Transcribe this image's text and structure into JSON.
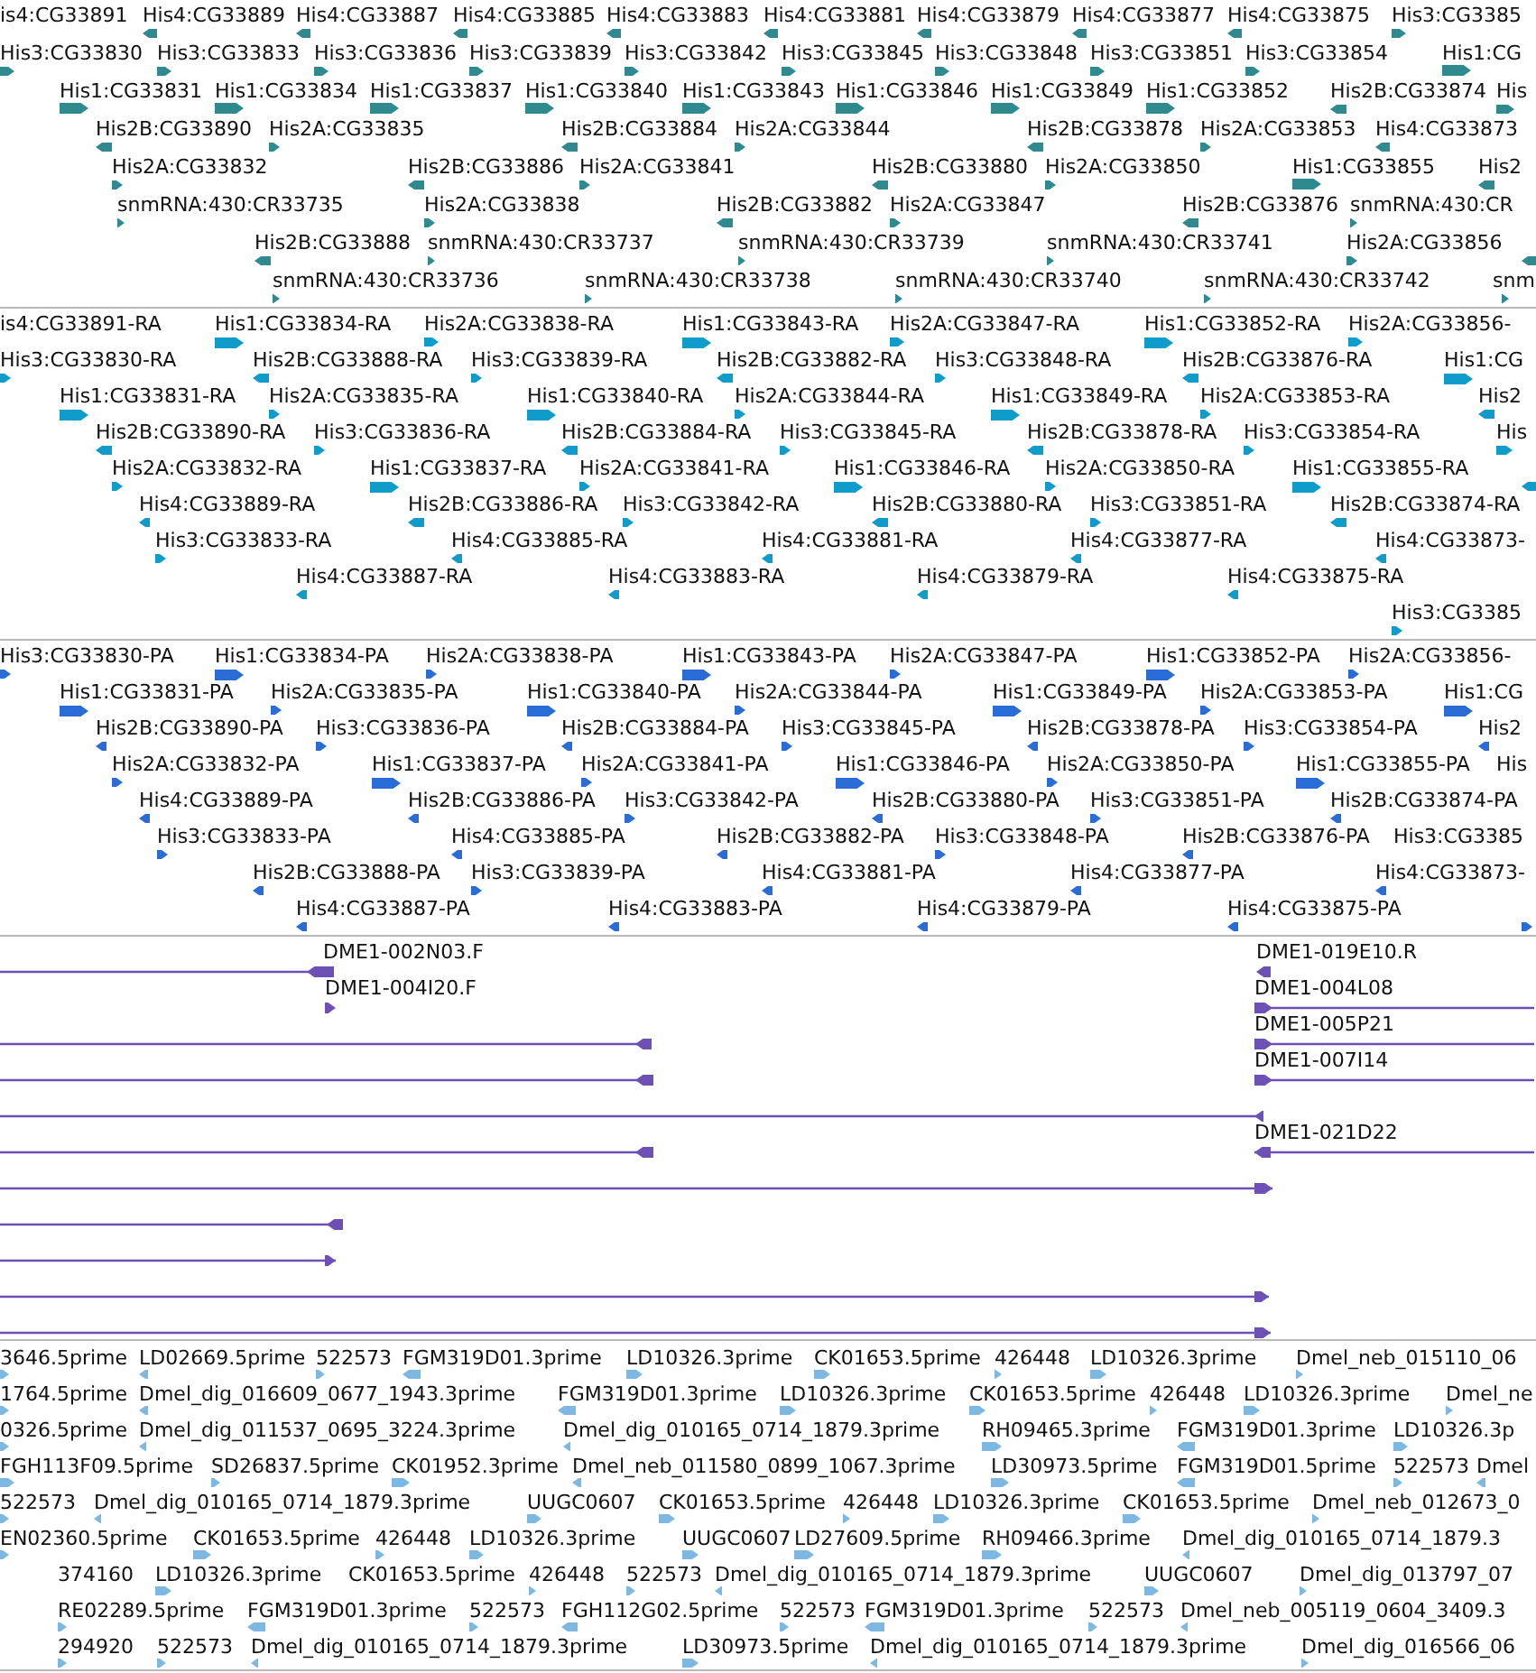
{
  "tracks": [
    {
      "kind": "glyph",
      "rows": [
        {
          "features": [
            {
              "label": "is4:CG33891"
            },
            {
              "label": "His4:CG33889",
              "reverse": true
            },
            {
              "label": "His4:CG33887",
              "reverse": true
            },
            {
              "label": "His4:CG33885",
              "reverse": true
            },
            {
              "label": "His4:CG33883",
              "reverse": true
            },
            {
              "label": "His4:CG33881",
              "reverse": true
            },
            {
              "label": "His4:CG33879",
              "reverse": true
            },
            {
              "label": "His4:CG33877",
              "reverse": true
            },
            {
              "label": "His4:CG33875",
              "reverse": true
            },
            {
              "label": "His3:CG3385",
              "reverse": false
            }
          ]
        },
        {
          "features": [
            {
              "label": "His3:CG33830",
              "reverse": false
            },
            {
              "label": "His3:CG33833",
              "reverse": false
            },
            {
              "label": "His3:CG33836",
              "reverse": false
            },
            {
              "label": "His3:CG33839",
              "reverse": false
            },
            {
              "label": "His3:CG33842",
              "reverse": false
            },
            {
              "label": "His3:CG33845",
              "reverse": false
            },
            {
              "label": "His3:CG33848",
              "reverse": false
            },
            {
              "label": "His3:CG33851",
              "reverse": false
            },
            {
              "label": "His3:CG33854",
              "reverse": false
            },
            {
              "label": "His1:CG",
              "reverse": false
            }
          ]
        },
        {
          "features": [
            {
              "label": "His1:CG33831",
              "reverse": false
            },
            {
              "label": "His1:CG33834",
              "reverse": false
            },
            {
              "label": "His1:CG33837",
              "reverse": false
            },
            {
              "label": "His1:CG33840",
              "reverse": false
            },
            {
              "label": "His1:CG33843",
              "reverse": false
            },
            {
              "label": "His1:CG33846",
              "reverse": false
            },
            {
              "label": "His1:CG33849",
              "reverse": false
            },
            {
              "label": "His1:CG33852",
              "reverse": false
            },
            {
              "label": "His2B:CG33874",
              "reverse": true
            },
            {
              "label": "His",
              "reverse": false
            }
          ]
        },
        {
          "features": [
            {
              "label": "His2B:CG33890",
              "reverse": true
            },
            {
              "label": "His2A:CG33835",
              "reverse": false
            },
            {
              "label": "His2B:CG33884",
              "reverse": true
            },
            {
              "label": "His2A:CG33844",
              "reverse": false
            },
            {
              "label": "His2B:CG33878",
              "reverse": true
            },
            {
              "label": "His2A:CG33853",
              "reverse": false
            },
            {
              "label": "His4:CG33873",
              "reverse": true
            }
          ]
        },
        {
          "features": [
            {
              "label": "His2A:CG33832",
              "reverse": false
            },
            {
              "label": "His2B:CG33886",
              "reverse": true
            },
            {
              "label": "His2A:CG33841",
              "reverse": false
            },
            {
              "label": "His2B:CG33880",
              "reverse": true
            },
            {
              "label": "His2A:CG33850",
              "reverse": false
            },
            {
              "label": "His1:CG33855",
              "reverse": false
            },
            {
              "label": "His2",
              "reverse": true
            }
          ]
        },
        {
          "features": [
            {
              "label": "snmRNA:430:CR33735",
              "reverse": false
            },
            {
              "label": "His2A:CG33838",
              "reverse": false
            },
            {
              "label": "His2B:CG33882",
              "reverse": true
            },
            {
              "label": "His2A:CG33847",
              "reverse": false
            },
            {
              "label": "His2B:CG33876",
              "reverse": true
            },
            {
              "label": "snmRNA:430:CR",
              "reverse": false
            }
          ]
        },
        {
          "features": [
            {
              "label": "His2B:CG33888",
              "reverse": true
            },
            {
              "label": "snmRNA:430:CR33737",
              "reverse": false
            },
            {
              "label": "snmRNA:430:CR33739",
              "reverse": false
            },
            {
              "label": "snmRNA:430:CR33741",
              "reverse": false
            },
            {
              "label": "His2A:CG33856",
              "reverse": false
            },
            {
              "reverse": true
            }
          ]
        },
        {
          "features": [
            {
              "label": "snmRNA:430:CR33736",
              "reverse": false
            },
            {
              "label": "snmRNA:430:CR33738",
              "reverse": false
            },
            {
              "label": "snmRNA:430:CR33740",
              "reverse": false
            },
            {
              "label": "snmRNA:430:CR33742",
              "reverse": false
            },
            {
              "label": "snm",
              "reverse": false
            }
          ]
        }
      ]
    },
    {
      "kind": "glyph",
      "rows": [
        {
          "features": [
            {
              "label": "is4:CG33891-RA"
            },
            {
              "label": "His1:CG33834-RA",
              "reverse": false
            },
            {
              "label": "His2A:CG33838-RA",
              "reverse": false
            },
            {
              "label": "His1:CG33843-RA",
              "reverse": false
            },
            {
              "label": "His2A:CG33847-RA",
              "reverse": false
            },
            {
              "label": "His1:CG33852-RA",
              "reverse": false
            },
            {
              "label": "His2A:CG33856-",
              "reverse": false
            }
          ]
        },
        {
          "features": [
            {
              "label": "His3:CG33830-RA",
              "reverse": false
            },
            {
              "label": "His2B:CG33888-RA",
              "reverse": true
            },
            {
              "label": "His3:CG33839-RA",
              "reverse": false
            },
            {
              "label": "His2B:CG33882-RA",
              "reverse": true
            },
            {
              "label": "His3:CG33848-RA",
              "reverse": false
            },
            {
              "label": "His2B:CG33876-RA",
              "reverse": true
            },
            {
              "label": "His1:CG",
              "reverse": false
            }
          ]
        },
        {
          "features": [
            {
              "label": "His1:CG33831-RA",
              "reverse": false
            },
            {
              "label": "His2A:CG33835-RA",
              "reverse": false
            },
            {
              "label": "His1:CG33840-RA",
              "reverse": false
            },
            {
              "label": "His2A:CG33844-RA",
              "reverse": false
            },
            {
              "label": "His1:CG33849-RA",
              "reverse": false
            },
            {
              "label": "His2A:CG33853-RA",
              "reverse": false
            },
            {
              "label": "His2",
              "reverse": true
            }
          ]
        },
        {
          "features": [
            {
              "label": "His2B:CG33890-RA",
              "reverse": true
            },
            {
              "label": "His3:CG33836-RA",
              "reverse": false
            },
            {
              "label": "His2B:CG33884-RA",
              "reverse": true
            },
            {
              "label": "His3:CG33845-RA",
              "reverse": false
            },
            {
              "label": "His2B:CG33878-RA",
              "reverse": true
            },
            {
              "label": "His3:CG33854-RA",
              "reverse": false
            },
            {
              "label": "His",
              "reverse": false
            }
          ]
        },
        {
          "features": [
            {
              "label": "His2A:CG33832-RA",
              "reverse": false
            },
            {
              "label": "His1:CG33837-RA",
              "reverse": false
            },
            {
              "label": "His2A:CG33841-RA",
              "reverse": false
            },
            {
              "label": "His1:CG33846-RA",
              "reverse": false
            },
            {
              "label": "His2A:CG33850-RA",
              "reverse": false
            },
            {
              "label": "His1:CG33855-RA",
              "reverse": false
            },
            {
              "reverse": true
            }
          ]
        },
        {
          "features": [
            {
              "label": "His4:CG33889-RA",
              "reverse": true
            },
            {
              "label": "His2B:CG33886-RA",
              "reverse": true
            },
            {
              "label": "His3:CG33842-RA",
              "reverse": false
            },
            {
              "label": "His2B:CG33880-RA",
              "reverse": true
            },
            {
              "label": "His3:CG33851-RA",
              "reverse": false
            },
            {
              "label": "His2B:CG33874-RA",
              "reverse": true
            }
          ]
        },
        {
          "features": [
            {
              "label": "His3:CG33833-RA",
              "reverse": false
            },
            {
              "label": "His4:CG33885-RA",
              "reverse": true
            },
            {
              "label": "His4:CG33881-RA",
              "reverse": true
            },
            {
              "label": "His4:CG33877-RA",
              "reverse": true
            },
            {
              "label": "His4:CG33873-",
              "reverse": true
            }
          ]
        },
        {
          "features": [
            {
              "label": "His4:CG33887-RA",
              "reverse": true
            },
            {
              "label": "His4:CG33883-RA",
              "reverse": true
            },
            {
              "label": "His4:CG33879-RA",
              "reverse": true
            },
            {
              "label": "His4:CG33875-RA",
              "reverse": true
            }
          ]
        },
        {
          "features": [
            {
              "label": "His3:CG3385",
              "reverse": false
            }
          ]
        }
      ]
    },
    {
      "kind": "glyph",
      "rows": [
        {
          "features": [
            {
              "label": "His3:CG33830-PA",
              "reverse": false
            },
            {
              "label": "His1:CG33834-PA",
              "reverse": false
            },
            {
              "label": "His2A:CG33838-PA",
              "reverse": false
            },
            {
              "label": "His1:CG33843-PA",
              "reverse": false
            },
            {
              "label": "His2A:CG33847-PA",
              "reverse": false
            },
            {
              "label": "His1:CG33852-PA",
              "reverse": false
            },
            {
              "label": "His2A:CG33856-",
              "reverse": false
            }
          ]
        },
        {
          "features": [
            {
              "label": "His1:CG33831-PA",
              "reverse": false
            },
            {
              "label": "His2A:CG33835-PA",
              "reverse": false
            },
            {
              "label": "His1:CG33840-PA",
              "reverse": false
            },
            {
              "label": "His2A:CG33844-PA",
              "reverse": false
            },
            {
              "label": "His1:CG33849-PA",
              "reverse": false
            },
            {
              "label": "His2A:CG33853-PA",
              "reverse": false
            },
            {
              "label": "His1:CG",
              "reverse": false
            }
          ]
        },
        {
          "features": [
            {
              "label": "His2B:CG33890-PA",
              "reverse": true
            },
            {
              "label": "His3:CG33836-PA",
              "reverse": false
            },
            {
              "label": "His2B:CG33884-PA",
              "reverse": true
            },
            {
              "label": "His3:CG33845-PA",
              "reverse": false
            },
            {
              "label": "His2B:CG33878-PA",
              "reverse": true
            },
            {
              "label": "His3:CG33854-PA",
              "reverse": false
            },
            {
              "label": "His2",
              "reverse": true
            }
          ]
        },
        {
          "features": [
            {
              "label": "His2A:CG33832-PA",
              "reverse": false
            },
            {
              "label": "His1:CG33837-PA",
              "reverse": false
            },
            {
              "label": "His2A:CG33841-PA",
              "reverse": false
            },
            {
              "label": "His1:CG33846-PA",
              "reverse": false
            },
            {
              "label": "His2A:CG33850-PA",
              "reverse": false
            },
            {
              "label": "His1:CG33855-PA",
              "reverse": false
            },
            {
              "label": "His"
            }
          ]
        },
        {
          "features": [
            {
              "label": "His4:CG33889-PA",
              "reverse": true
            },
            {
              "label": "His2B:CG33886-PA",
              "reverse": true
            },
            {
              "label": "His3:CG33842-PA",
              "reverse": false
            },
            {
              "label": "His2B:CG33880-PA",
              "reverse": true
            },
            {
              "label": "His3:CG33851-PA",
              "reverse": false
            },
            {
              "label": "His2B:CG33874-PA",
              "reverse": true
            }
          ]
        },
        {
          "features": [
            {
              "label": "His3:CG33833-PA",
              "reverse": false
            },
            {
              "label": "His4:CG33885-PA",
              "reverse": true
            },
            {
              "label": "His2B:CG33882-PA",
              "reverse": true
            },
            {
              "label": "His3:CG33848-PA",
              "reverse": false
            },
            {
              "label": "His2B:CG33876-PA",
              "reverse": true
            },
            {
              "label": "His3:CG3385"
            }
          ]
        },
        {
          "features": [
            {
              "label": "His2B:CG33888-PA",
              "reverse": true
            },
            {
              "label": "His3:CG33839-PA",
              "reverse": false
            },
            {
              "label": "His4:CG33881-PA",
              "reverse": true
            },
            {
              "label": "His4:CG33877-PA",
              "reverse": true
            },
            {
              "label": "His4:CG33873-",
              "reverse": true
            }
          ]
        },
        {
          "features": [
            {
              "label": "His4:CG33887-PA",
              "reverse": true
            },
            {
              "label": "His4:CG33883-PA",
              "reverse": true
            },
            {
              "label": "His4:CG33879-PA",
              "reverse": true
            },
            {
              "label": "His4:CG33875-PA",
              "reverse": true
            },
            {
              "reverse": false
            }
          ]
        }
      ]
    },
    {
      "kind": "span",
      "rows": [
        {
          "features": [
            {
              "label": "DME1-002N03.F",
              "reverse": true
            },
            {
              "label": "DME1-019E10.R",
              "reverse": true
            }
          ]
        },
        {
          "features": [
            {
              "label": "DME1-004I20.F",
              "reverse": false
            },
            {
              "label": "DME1-004L08",
              "reverse": false
            }
          ]
        },
        {
          "features": [
            {
              "reverse": true
            },
            {
              "label": "DME1-005P21",
              "reverse": false
            }
          ]
        },
        {
          "features": [
            {
              "reverse": true
            },
            {
              "label": "DME1-007I14",
              "reverse": false
            }
          ]
        },
        {
          "features": [
            {
              "reverse": true
            }
          ]
        },
        {
          "features": [
            {
              "reverse": true
            },
            {
              "label": "DME1-021D22",
              "reverse": true
            }
          ]
        },
        {
          "features": [
            {
              "reverse": false
            }
          ]
        },
        {
          "features": [
            {
              "reverse": true
            }
          ]
        },
        {
          "features": [
            {
              "reverse": false
            }
          ]
        },
        {
          "features": [
            {
              "reverse": false
            }
          ]
        },
        {
          "features": [
            {
              "reverse": false
            }
          ]
        }
      ]
    },
    {
      "kind": "glyph",
      "rows": [
        {
          "features": [
            {
              "label": "3646.5prime",
              "reverse": false
            },
            {
              "label": "LD02669.5prime",
              "reverse": true
            },
            {
              "label": "522573",
              "reverse": false
            },
            {
              "label": "FGM319D01.3prime",
              "reverse": true
            },
            {
              "label": "LD10326.3prime",
              "reverse": false
            },
            {
              "label": "CK01653.5prime",
              "reverse": false
            },
            {
              "label": "426448",
              "reverse": false
            },
            {
              "label": "LD10326.3prime",
              "reverse": false
            },
            {
              "label": "Dmel_neb_015110_06",
              "reverse": false
            }
          ]
        },
        {
          "features": [
            {
              "label": "1764.5prime",
              "reverse": false
            },
            {
              "label": "Dmel_dig_016609_0677_1943.3prime",
              "reverse": true
            },
            {
              "label": "FGM319D01.3prime",
              "reverse": true
            },
            {
              "label": "LD10326.3prime",
              "reverse": false
            },
            {
              "label": "CK01653.5prime",
              "reverse": false
            },
            {
              "label": "426448",
              "reverse": false
            },
            {
              "label": "LD10326.3prime",
              "reverse": false
            },
            {
              "label": "Dmel_ne",
              "reverse": false
            }
          ]
        },
        {
          "features": [
            {
              "label": "0326.5prime",
              "reverse": false
            },
            {
              "label": "Dmel_dig_011537_0695_3224.3prime",
              "reverse": true
            },
            {
              "label": "Dmel_dig_010165_0714_1879.3prime",
              "reverse": true
            },
            {
              "label": "RH09465.3prime",
              "reverse": false
            },
            {
              "label": "FGM319D01.3prime",
              "reverse": true
            },
            {
              "label": "LD10326.3p",
              "reverse": false
            }
          ]
        },
        {
          "features": [
            {
              "label": "FGH113F09.5prime",
              "reverse": false
            },
            {
              "label": "SD26837.5prime",
              "reverse": false
            },
            {
              "label": "CK01952.3prime",
              "reverse": false
            },
            {
              "label": "Dmel_neb_011580_0899_1067.3prime",
              "reverse": true
            },
            {
              "label": "LD30973.5prime",
              "reverse": false
            },
            {
              "label": "FGM319D01.5prime",
              "reverse": true
            },
            {
              "label": "522573",
              "reverse": false
            },
            {
              "label": "Dmel",
              "reverse": true
            }
          ]
        },
        {
          "features": [
            {
              "label": "522573",
              "reverse": false
            },
            {
              "label": "Dmel_dig_010165_0714_1879.3prime",
              "reverse": true
            },
            {
              "label": "UUGC0607",
              "reverse": false
            },
            {
              "label": "CK01653.5prime",
              "reverse": false
            },
            {
              "label": "426448",
              "reverse": false
            },
            {
              "label": "LD10326.3prime",
              "reverse": false
            },
            {
              "label": "CK01653.5prime",
              "reverse": false
            },
            {
              "label": "Dmel_neb_012673_0",
              "reverse": false
            }
          ]
        },
        {
          "features": [
            {
              "label": "EN02360.5prime",
              "reverse": false
            },
            {
              "label": "CK01653.5prime",
              "reverse": false
            },
            {
              "label": "426448",
              "reverse": false
            },
            {
              "label": "LD10326.3prime",
              "reverse": false
            },
            {
              "label": "UUGC0607",
              "reverse": false
            },
            {
              "label": "LD27609.5prime",
              "reverse": false
            },
            {
              "label": "RH09466.3prime",
              "reverse": false
            },
            {
              "label": "Dmel_dig_010165_0714_1879.3",
              "reverse": true
            }
          ]
        },
        {
          "features": [
            {
              "label": "374160"
            },
            {
              "label": "LD10326.3prime",
              "reverse": false
            },
            {
              "label": "CK01653.5prime"
            },
            {
              "label": "426448",
              "reverse": false
            },
            {
              "label": "522573",
              "reverse": false
            },
            {
              "label": "Dmel_dig_010165_0714_1879.3prime",
              "reverse": true
            },
            {
              "label": "UUGC0607",
              "reverse": false
            },
            {
              "label": "Dmel_dig_013797_07",
              "reverse": false
            }
          ]
        },
        {
          "features": [
            {
              "label": "RE02289.5prime",
              "reverse": false
            },
            {
              "label": "FGM319D01.3prime",
              "reverse": true
            },
            {
              "label": "522573",
              "reverse": false
            },
            {
              "label": "FGH112G02.5prime",
              "reverse": true
            },
            {
              "label": "522573",
              "reverse": false
            },
            {
              "label": "FGM319D01.3prime",
              "reverse": true
            },
            {
              "label": "522573",
              "reverse": false
            },
            {
              "label": "Dmel_neb_005119_0604_3409.3",
              "reverse": true
            }
          ]
        },
        {
          "features": [
            {
              "label": "294920",
              "reverse": false
            },
            {
              "label": "522573",
              "reverse": false
            },
            {
              "label": "Dmel_dig_010165_0714_1879.3prime",
              "reverse": true
            },
            {
              "label": "LD30973.5prime",
              "reverse": false
            },
            {
              "label": "Dmel_dig_010165_0714_1879.3prime",
              "reverse": true
            },
            {
              "label": "Dmel_dig_016566_06",
              "reverse": false
            }
          ]
        }
      ]
    }
  ]
}
